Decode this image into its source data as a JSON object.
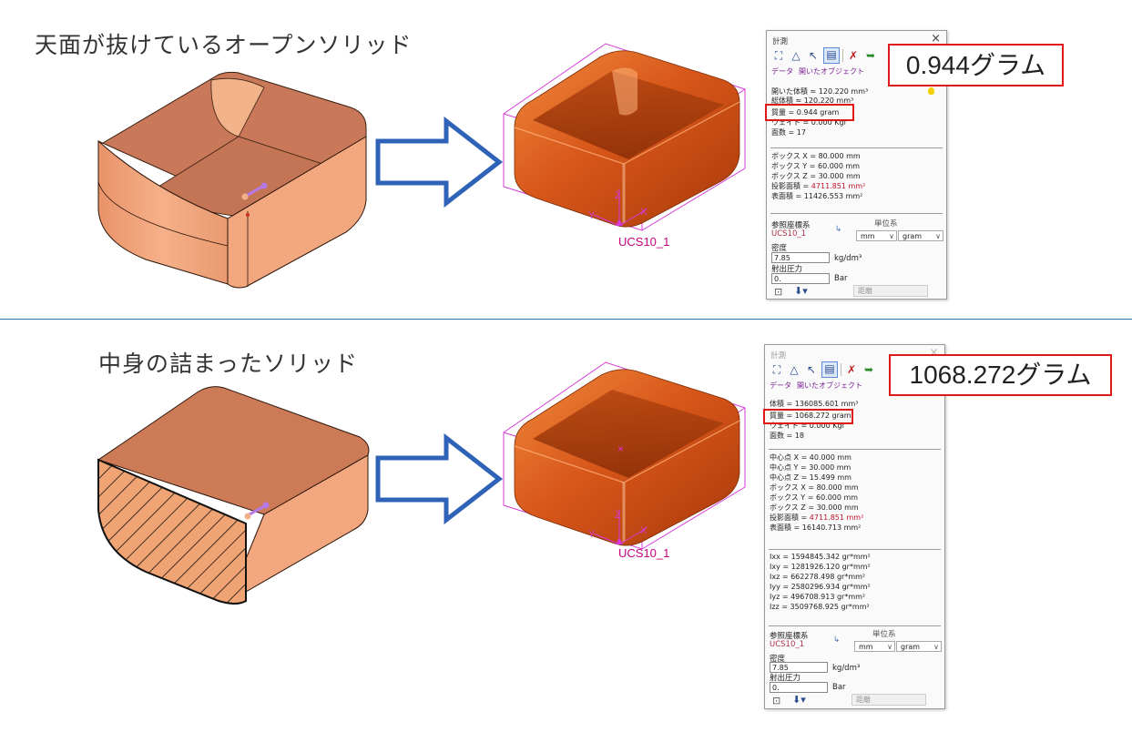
{
  "top": {
    "heading": "天面が抜けているオープンソリッド",
    "ucs_label": "UCS10_1",
    "panel": {
      "title": "計測",
      "close": "×",
      "tab_data": "データ",
      "tab_open": "開いたオブジェクト",
      "lines": [
        "開いた体積 ≈  120.220 mm³",
        "総体積 ≈    120.220 mm³",
        "質量 =      0.944 gram",
        "ウェイト =   0.000 Kgf",
        "面数 = 17"
      ],
      "box_lines": [
        "ボックス X = 80.000 mm",
        "ボックス Y = 60.000 mm",
        "ボックス Z = 30.000 mm"
      ],
      "projected_label": "投影面積 = ",
      "projected_value": "4711.851 mm²",
      "surface_line": "表面積 =   11426.553 mm²",
      "ref_cs_label": "参照座標系",
      "ref_cs_value": "UCS10_1",
      "unit_label": "単位系",
      "unit_length": "mm",
      "unit_mass": "gram",
      "density_label": "密度",
      "density_value": "7.85",
      "density_unit": "kg/dm³",
      "pressure_label": "射出圧力",
      "pressure_value": "0.",
      "pressure_unit": "Bar",
      "distance": "距離"
    },
    "callout": "0.944グラム"
  },
  "bottom": {
    "heading": "中身の詰まったソリッド",
    "ucs_label": "UCS10_1",
    "panel": {
      "title": "計測",
      "close": "×",
      "tab_data": "データ",
      "tab_open": "開いたオブジェクト",
      "lines": [
        "体積 =  136085.601 mm³",
        "質量 =    1068.272 gram",
        "ウェイト =   0.000 Kgf",
        "面数 = 18"
      ],
      "center_lines": [
        "中心点 X =   40.000 mm",
        "中心点 Y =   30.000 mm",
        "中心点 Z =   15.499 mm",
        "ボックス X = 80.000 mm",
        "ボックス Y = 60.000 mm",
        "ボックス Z = 30.000 mm"
      ],
      "projected_label": "投影面積 = ",
      "projected_value": "4711.851 mm²",
      "surface_line": "表面積 =   16140.713 mm²",
      "inertia_lines": [
        "Ixx = 1594845.342 gr*mm²",
        "Ixy = 1281926.120 gr*mm²",
        "Ixz =  662278.498 gr*mm²",
        "Iyy = 2580296.934 gr*mm²",
        "Iyz =  496708.913 gr*mm²",
        "Izz = 3509768.925 gr*mm²"
      ],
      "ref_cs_label": "参照座標系",
      "ref_cs_value": "UCS10_1",
      "unit_label": "単位系",
      "unit_length": "mm",
      "unit_mass": "gram",
      "density_label": "密度",
      "density_value": "7.85",
      "density_unit": "kg/dm³",
      "pressure_label": "射出圧力",
      "pressure_value": "0.",
      "pressure_unit": "Bar",
      "distance": "距離"
    },
    "callout": "1068.272グラム"
  },
  "colors": {
    "arrow_blue": "#2f63b8",
    "callout_red": "#e01818",
    "copper_light": "#f3a578",
    "copper_dark": "#c0521a",
    "bbox_magenta": "#d63ad6"
  }
}
